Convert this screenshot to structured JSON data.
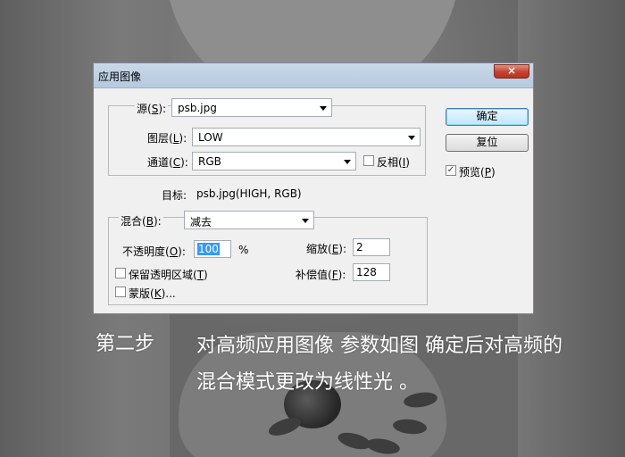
{
  "dialog": {
    "title": "应用图像",
    "close_icon": "close-icon",
    "source": {
      "label": "源",
      "mnemonic": "S",
      "value": "psb.jpg"
    },
    "layer": {
      "label": "图层",
      "mnemonic": "L",
      "value": "LOW"
    },
    "channel": {
      "label": "通道",
      "mnemonic": "C",
      "value": "RGB"
    },
    "invert": {
      "label": "反相",
      "mnemonic": "I",
      "checked": false
    },
    "target": {
      "label": "目标:",
      "value": "psb.jpg(HIGH, RGB)"
    },
    "blending": {
      "label": "混合",
      "mnemonic": "B",
      "value": "减去"
    },
    "opacity": {
      "label": "不透明度",
      "mnemonic": "O",
      "value": "100",
      "unit": "%"
    },
    "scale": {
      "label": "缩放",
      "mnemonic": "E",
      "value": "2"
    },
    "offset": {
      "label": "补偿值",
      "mnemonic": "F",
      "value": "128"
    },
    "preserve_transparency": {
      "label": "保留透明区域",
      "mnemonic": "T",
      "checked": false
    },
    "mask": {
      "label": "蒙版",
      "mnemonic": "K",
      "suffix": "...",
      "checked": false
    },
    "ok_button": "确定",
    "reset_button": "复位",
    "preview": {
      "label": "预览",
      "mnemonic": "P",
      "checked": true
    }
  },
  "caption": {
    "step": "第二步",
    "line1": "对高频应用图像 参数如图 确定后对高频的",
    "line2": "混合模式更改为线性光 。"
  }
}
